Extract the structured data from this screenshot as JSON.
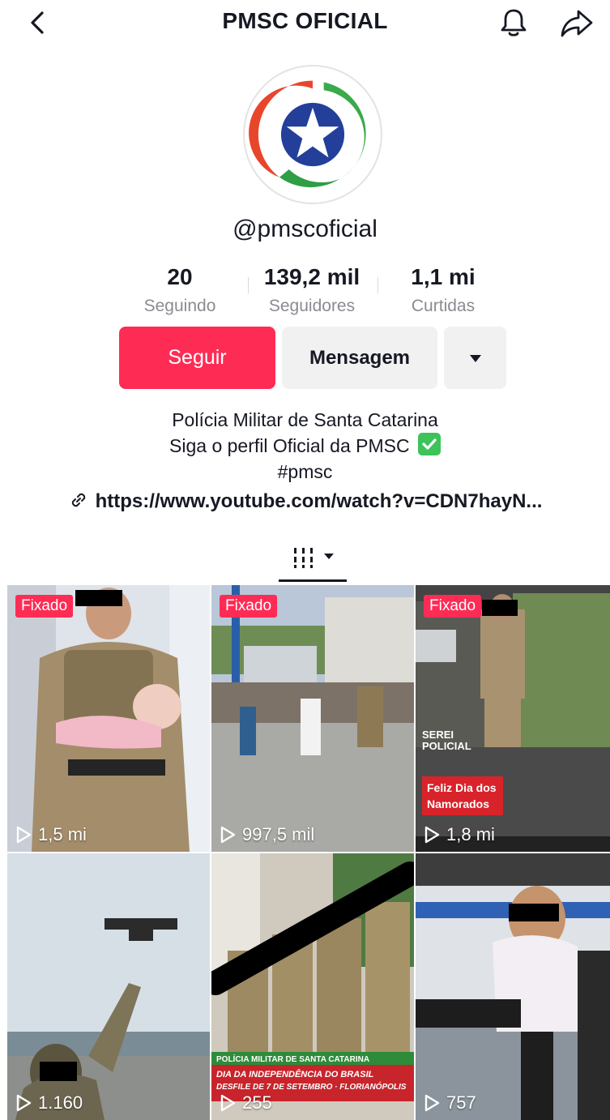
{
  "header": {
    "title": "PMSC OFICIAL",
    "back_icon": "chevron-left-icon",
    "notification_icon": "bell-icon",
    "share_icon": "share-arrow-icon"
  },
  "profile": {
    "handle": "@pmscoficial",
    "stats": [
      {
        "value": "20",
        "label": "Seguindo"
      },
      {
        "value": "139,2 mil",
        "label": "Seguidores"
      },
      {
        "value": "1,1 mi",
        "label": "Curtidas"
      }
    ],
    "buttons": {
      "follow": "Seguir",
      "message": "Mensagem",
      "more_icon": "caret-down-icon"
    },
    "bio": {
      "line1": "Polícia Militar de Santa Catarina",
      "line2": "Siga o perfil Oficial da PMSC",
      "line3": "#pmsc"
    },
    "link": "https://www.youtube.com/watch?v=CDN7hayN..."
  },
  "tabs": {
    "active_icon": "grid-icon"
  },
  "colors": {
    "accent": "#fe2c55",
    "secondary_button": "#f1f1f2",
    "muted_text": "#8a8b91"
  },
  "videos": [
    {
      "pinned": "Fixado",
      "views": "1,5 mi"
    },
    {
      "pinned": "Fixado",
      "views": "997,5 mil"
    },
    {
      "pinned": "Fixado",
      "views": "1,8 mi",
      "overlay_text": "Feliz Dia dos Namorados",
      "overlay_small": "SEREI POLICIAL"
    },
    {
      "views": "1.160"
    },
    {
      "views": "255",
      "banner_top": "POLÍCIA MILITAR DE SANTA CATARINA",
      "banner_line1": "DIA DA INDEPENDÊNCIA DO BRASIL",
      "banner_line2": "DESFILE DE 7 DE SETEMBRO · FLORIANÓPOLIS"
    },
    {
      "views": "757"
    }
  ]
}
